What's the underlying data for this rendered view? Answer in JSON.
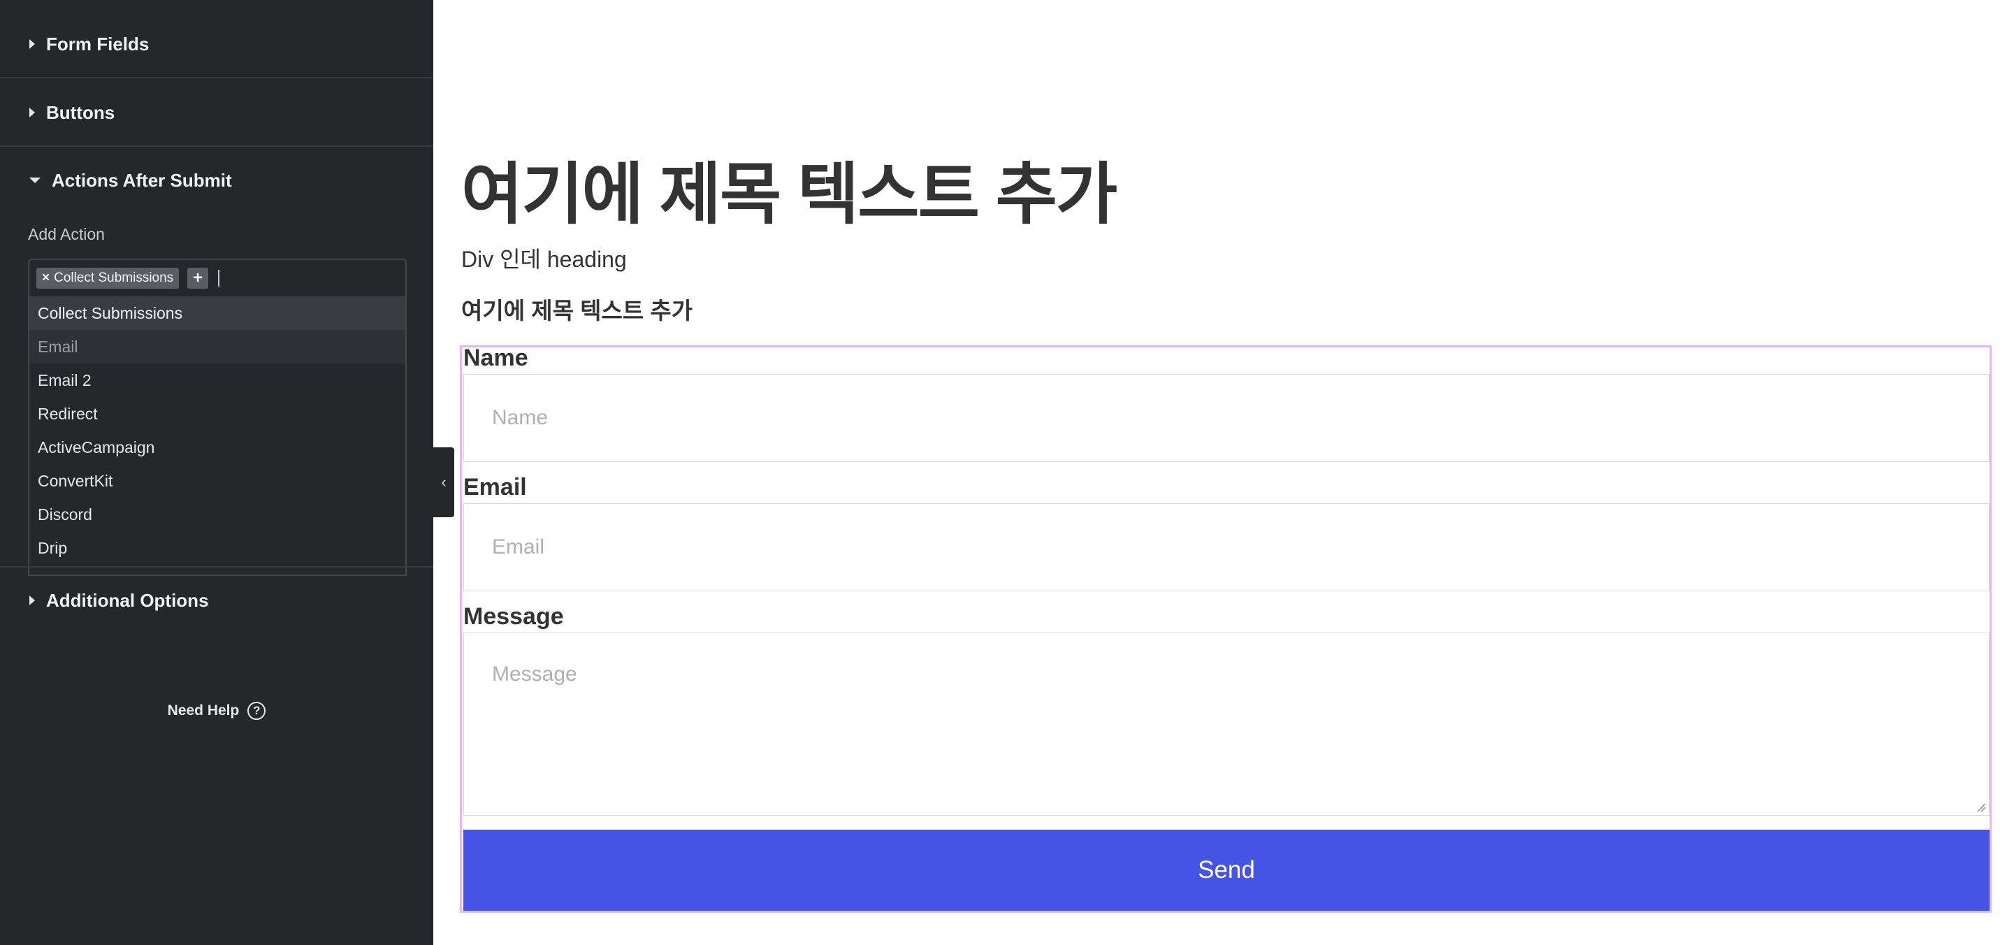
{
  "sidebar": {
    "sections": {
      "form_fields": "Form Fields",
      "buttons": "Buttons",
      "actions_after_submit": "Actions After Submit",
      "additional_options": "Additional Options"
    },
    "add_action": {
      "label": "Add Action",
      "selected_chip": "Collect Submissions",
      "chip_remove": "×",
      "add_symbol": "+",
      "options": [
        "Collect Submissions",
        "Email",
        "Email 2",
        "Redirect",
        "ActiveCampaign",
        "ConvertKit",
        "Discord",
        "Drip"
      ]
    },
    "need_help": "Need Help",
    "help_symbol": "?",
    "collapse_symbol": "‹"
  },
  "canvas": {
    "page_heading": "여기에 제목 텍스트 추가",
    "div_text": "Div 인데 heading",
    "sub_heading": "여기에 제목 텍스트 추가",
    "form": {
      "name_label": "Name",
      "name_placeholder": "Name",
      "email_label": "Email",
      "email_placeholder": "Email",
      "message_label": "Message",
      "message_placeholder": "Message",
      "send_label": "Send"
    }
  },
  "colors": {
    "panel_bg": "#26272b",
    "send_button": "#4654e6",
    "form_outline": "#e9b5f2"
  }
}
